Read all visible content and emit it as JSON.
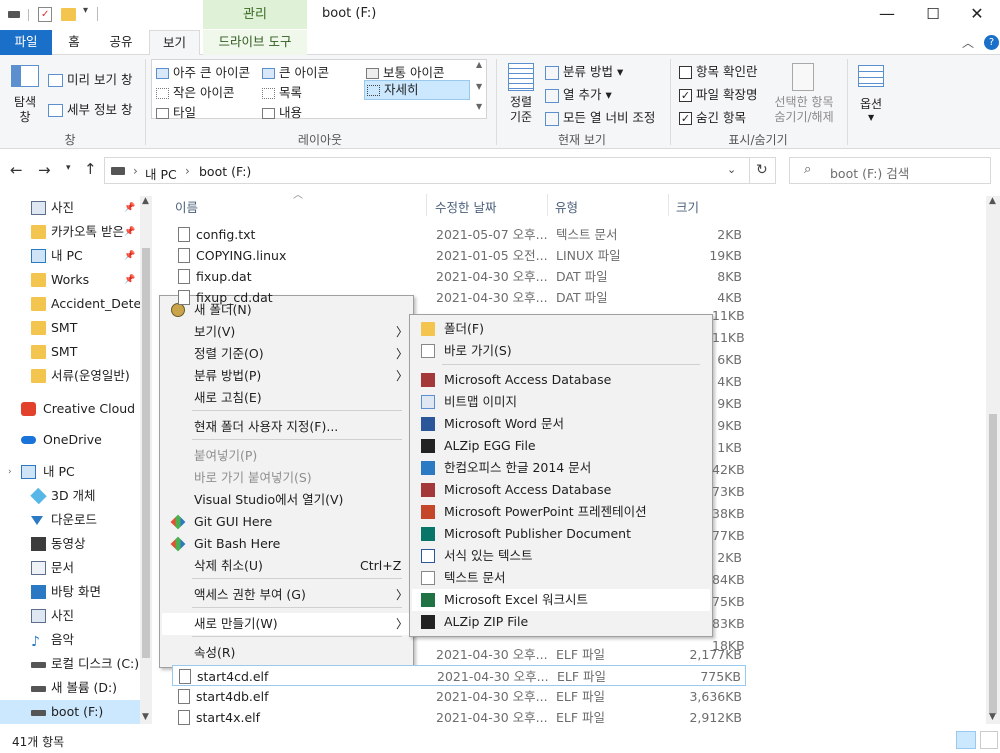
{
  "window": {
    "title": "boot (F:)",
    "contextual_tab_header": "관리",
    "minimize": "—",
    "maximize": "☐",
    "close": "✕"
  },
  "tabs": [
    "파일",
    "홈",
    "공유",
    "보기",
    "드라이브 도구"
  ],
  "ribbon": {
    "pane_group": {
      "nav_pane": "탐색\n창",
      "preview_pane": "미리 보기 창",
      "details_pane": "세부 정보 창",
      "label": "창"
    },
    "layout_group": {
      "items": [
        "아주 큰 아이콘",
        "큰 아이콘",
        "보통 아이콘",
        "작은 아이콘",
        "목록",
        "자세히",
        "타일",
        "내용"
      ],
      "selected": "자세히",
      "label": "레이아웃"
    },
    "current_view_group": {
      "sort": "정렬\n기준",
      "group_by": "분류 방법",
      "add_columns": "열 추가",
      "fit_columns": "모든 열 너비 조정",
      "label": "현재 보기"
    },
    "show_hide_group": {
      "item_checkboxes": "항목 확인란",
      "file_extensions": "파일 확장명",
      "hidden_items": "숨긴 항목",
      "hide_selected": "선택한 항목\n숨기기/해제",
      "label": "표시/숨기기"
    },
    "options": "옵션"
  },
  "address": {
    "path": [
      "내 PC",
      "boot (F:)"
    ],
    "search_placeholder": "boot (F:) 검색"
  },
  "nav_pane": {
    "items": [
      {
        "label": "사진",
        "icon": "pictures-icon",
        "pinned": true
      },
      {
        "label": "카카오톡 받은",
        "icon": "folder-icon",
        "pinned": true
      },
      {
        "label": "내 PC",
        "icon": "pc-icon",
        "pinned": true
      },
      {
        "label": "Works",
        "icon": "folder-icon",
        "pinned": true
      },
      {
        "label": "Accident_Detect",
        "icon": "folder-icon",
        "pinned": false
      },
      {
        "label": "SMT",
        "icon": "folder-icon",
        "pinned": false
      },
      {
        "label": "SMT",
        "icon": "folder-icon",
        "pinned": false
      },
      {
        "label": "서류(운영일반)",
        "icon": "folder-icon",
        "pinned": false
      },
      {
        "label": "Creative Cloud Fil",
        "icon": "creative-cloud-icon",
        "pinned": false
      },
      {
        "label": "OneDrive",
        "icon": "onedrive-icon",
        "pinned": false
      },
      {
        "label": "내 PC",
        "icon": "pc-icon",
        "pinned": false
      },
      {
        "label": "3D 개체",
        "icon": "3d-objects-icon",
        "pinned": false
      },
      {
        "label": "다운로드",
        "icon": "downloads-icon",
        "pinned": false
      },
      {
        "label": "동영상",
        "icon": "videos-icon",
        "pinned": false
      },
      {
        "label": "문서",
        "icon": "documents-icon",
        "pinned": false
      },
      {
        "label": "바탕 화면",
        "icon": "desktop-icon",
        "pinned": false
      },
      {
        "label": "사진",
        "icon": "pictures-icon",
        "pinned": false
      },
      {
        "label": "음악",
        "icon": "music-icon",
        "pinned": false
      },
      {
        "label": "로컬 디스크 (C:)",
        "icon": "drive-icon",
        "pinned": false
      },
      {
        "label": "새 볼륨 (D:)",
        "icon": "drive-icon",
        "pinned": false
      },
      {
        "label": "boot (F:)",
        "icon": "drive-icon",
        "pinned": false
      }
    ]
  },
  "columns": [
    "이름",
    "수정한 날짜",
    "유형",
    "크기"
  ],
  "files": [
    {
      "name": "config.txt",
      "date": "2021-05-07 오후...",
      "type": "텍스트 문서",
      "size": "2KB"
    },
    {
      "name": "COPYING.linux",
      "date": "2021-01-05 오전...",
      "type": "LINUX 파일",
      "size": "19KB"
    },
    {
      "name": "fixup.dat",
      "date": "2021-04-30 오후...",
      "type": "DAT 파일",
      "size": "8KB"
    },
    {
      "name": "fixup_cd.dat",
      "date": "2021-04-30 오후...",
      "type": "DAT 파일",
      "size": "4KB"
    }
  ],
  "hidden_sizes": [
    "11KB",
    "11KB",
    "6KB",
    "4KB",
    "9KB",
    "9KB",
    "1KB",
    "42KB",
    "73KB",
    "38KB",
    "77KB",
    "2KB",
    "84KB",
    "75KB",
    "83KB",
    "18KB"
  ],
  "files_bottom": [
    {
      "name": "start4cd.elf",
      "date": "2021-04-30 오후...",
      "type": "ELF 파일",
      "size": "775KB",
      "selected": true
    },
    {
      "name": "start4db.elf",
      "date": "2021-04-30 오후...",
      "type": "ELF 파일",
      "size": "3,636KB"
    },
    {
      "name": "start4x.elf",
      "date": "2021-04-30 오후...",
      "type": "ELF 파일",
      "size": "2,912KB"
    }
  ],
  "partial_row": {
    "date": "2021-04-30 오후...",
    "type": "ELF 파일",
    "size": "2,177KB"
  },
  "context_menu": {
    "items": [
      {
        "label": "새 폴더(N)",
        "icon": "new-folder-icon"
      },
      {
        "label": "보기(V)",
        "arrow": true
      },
      {
        "label": "정렬 기준(O)",
        "arrow": true
      },
      {
        "label": "분류 방법(P)",
        "arrow": true
      },
      {
        "label": "새로 고침(E)"
      },
      {
        "label": "현재 폴더 사용자 지정(F)..."
      },
      {
        "label": "붙여넣기(P)",
        "disabled": true
      },
      {
        "label": "바로 가기 붙여넣기(S)",
        "disabled": true
      },
      {
        "label": "Visual Studio에서 열기(V)"
      },
      {
        "label": "Git GUI Here",
        "icon": "git-icon"
      },
      {
        "label": "Git Bash Here",
        "icon": "git-icon"
      },
      {
        "label": "삭제 취소(U)",
        "shortcut": "Ctrl+Z"
      },
      {
        "label": "액세스 권한 부여 (G)",
        "arrow": true
      },
      {
        "label": "새로 만들기(W)",
        "arrow": true,
        "highlighted": true
      },
      {
        "label": "속성(R)"
      }
    ]
  },
  "submenu": {
    "items": [
      {
        "label": "폴더(F)",
        "icon": "folder-icon"
      },
      {
        "label": "바로 가기(S)",
        "icon": "shortcut-icon"
      },
      {
        "label": "Microsoft Access Database",
        "icon": "access-icon"
      },
      {
        "label": "비트맵 이미지",
        "icon": "bitmap-icon"
      },
      {
        "label": "Microsoft Word 문서",
        "icon": "word-icon"
      },
      {
        "label": "ALZip EGG File",
        "icon": "egg-icon"
      },
      {
        "label": "한컴오피스 한글 2014 문서",
        "icon": "hwp-icon"
      },
      {
        "label": "Microsoft Access Database",
        "icon": "access-icon"
      },
      {
        "label": "Microsoft PowerPoint 프레젠테이션",
        "icon": "powerpoint-icon"
      },
      {
        "label": "Microsoft Publisher Document",
        "icon": "publisher-icon"
      },
      {
        "label": "서식 있는 텍스트",
        "icon": "rtf-icon"
      },
      {
        "label": "텍스트 문서",
        "icon": "text-icon"
      },
      {
        "label": "Microsoft Excel 워크시트",
        "icon": "excel-icon",
        "highlighted": true
      },
      {
        "label": "ALZip ZIP File",
        "icon": "zip-icon"
      }
    ]
  },
  "status": {
    "count": "41개 항목"
  },
  "colors": {
    "accent": "#1a6fc9",
    "context_tab": "#dff1d6",
    "selection": "#cce8ff"
  }
}
